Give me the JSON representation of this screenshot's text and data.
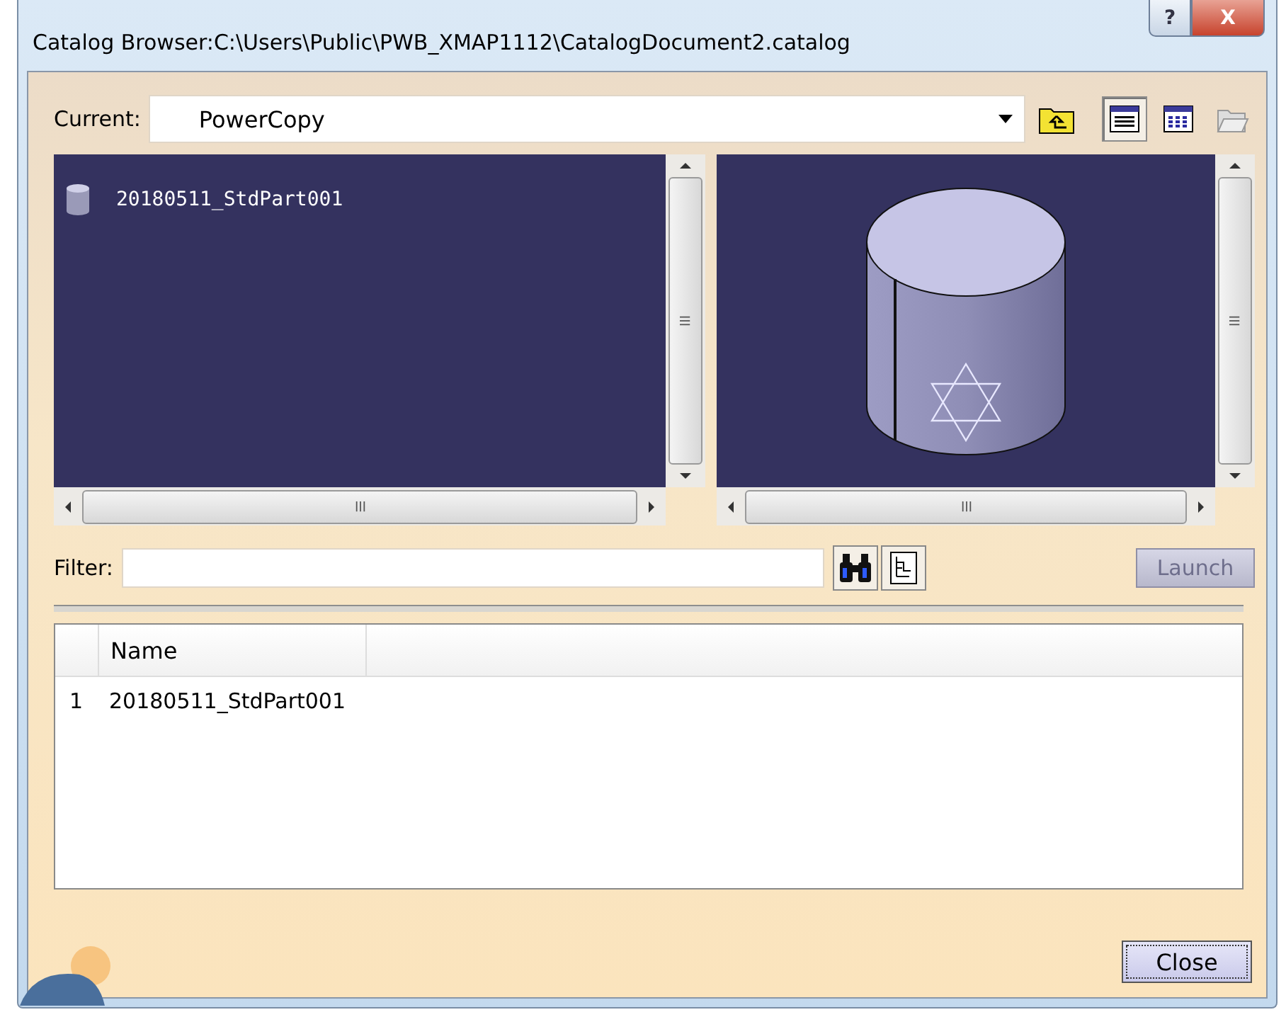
{
  "window": {
    "title": "Catalog Browser:C:\\Users\\Public\\PWB_XMAP1112\\CatalogDocument2.catalog",
    "help": "?",
    "close": "X"
  },
  "current": {
    "label": "Current:",
    "value": "PowerCopy"
  },
  "view_modes": [
    {
      "selected": true
    },
    {
      "selected": false
    }
  ],
  "list_view": {
    "items": [
      {
        "name": "20180511_StdPart001",
        "selected": false
      }
    ]
  },
  "filter": {
    "label": "Filter:"
  },
  "launch_button": {
    "label": "Launch",
    "disabled": true
  },
  "table": {
    "columns": [
      "Name"
    ],
    "rows": [
      {
        "index": "1",
        "name": "20180511_StdPart001"
      }
    ]
  },
  "close_button": {
    "label": "Close",
    "disabled": false
  }
}
